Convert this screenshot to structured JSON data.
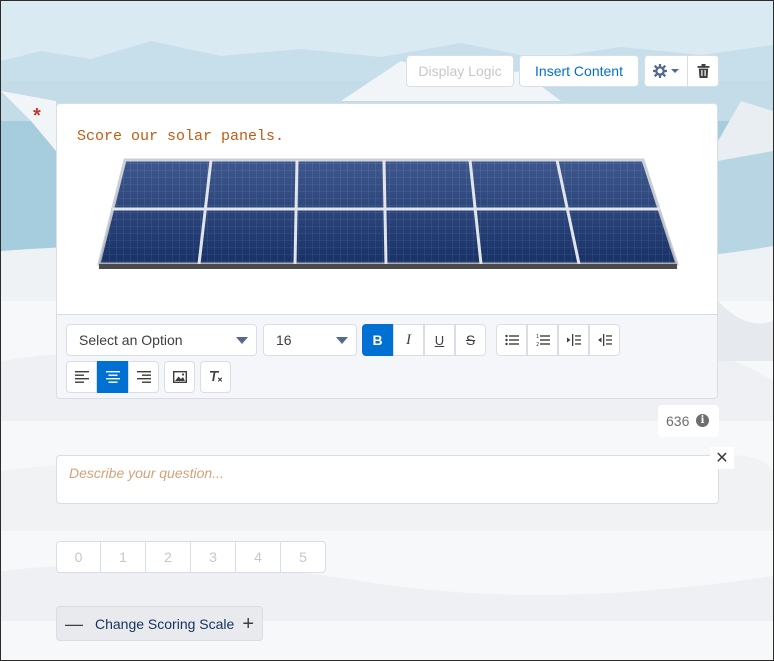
{
  "header": {
    "display_logic_label": "Display Logic",
    "insert_content_label": "Insert Content"
  },
  "question": {
    "required_mark": "*",
    "text": "Score our solar panels.",
    "char_count": "636",
    "description_placeholder": "Describe your question..."
  },
  "toolbar": {
    "style_select": "Select an Option",
    "font_size": "16"
  },
  "scale": {
    "options": [
      "0",
      "1",
      "2",
      "3",
      "4",
      "5"
    ],
    "change_label": "Change Scoring Scale"
  },
  "colors": {
    "brand": "#0070d2",
    "question_text": "#c55a11",
    "required": "#c23934"
  }
}
